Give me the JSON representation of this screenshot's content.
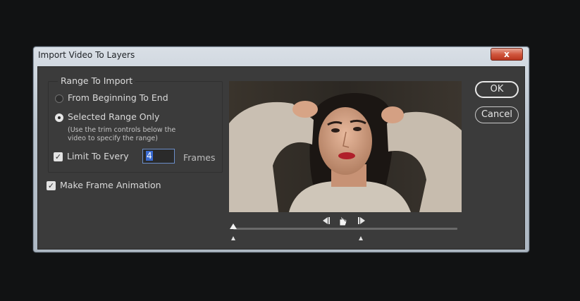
{
  "dialog": {
    "title": "Import Video To Layers",
    "close_label": "x",
    "range_group": {
      "title": "Range To Import",
      "option_all": "From Beginning To End",
      "option_selected": "Selected Range Only",
      "hint_line1": "(Use the trim controls below the",
      "hint_line2": "video to specify the range)",
      "selected": "selected"
    },
    "limit": {
      "label": "Limit To Every",
      "checked": true,
      "value": "4",
      "unit": "Frames"
    },
    "frame_animation": {
      "label": "Make Frame Animation",
      "checked": true
    },
    "buttons": {
      "ok": "OK",
      "cancel": "Cancel"
    }
  },
  "icons": {
    "close": "close-icon",
    "step_back": "step-back-icon",
    "play": "play-icon",
    "step_forward": "step-forward-icon",
    "hand_cursor": "hand-cursor-icon",
    "playhead": "playhead-icon",
    "trim_start": "trim-start-icon",
    "trim_end": "trim-end-icon"
  },
  "colors": {
    "page_background": "#111213",
    "panel_background": "#3b3b3b",
    "input_focus": "#6b8ec9",
    "selection": "#3a6bd1",
    "close_button": "#d0573e"
  }
}
